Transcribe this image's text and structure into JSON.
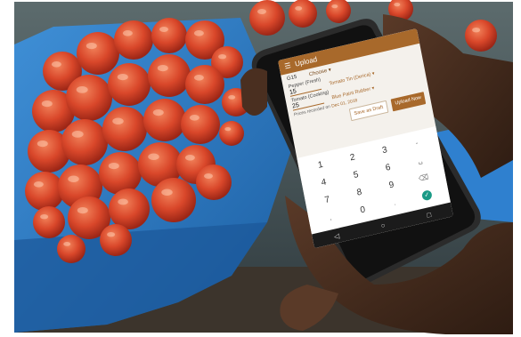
{
  "app": {
    "title": "Upload",
    "market": "G15",
    "market_dropdown": "Choose",
    "fields": [
      {
        "label": "Pepper (Fresh)",
        "value": "15",
        "unit": "Tomato Tin (Derica)"
      },
      {
        "label": "Tomato (Cooking)",
        "value": "25",
        "unit": "Blue Paint Rubber"
      }
    ],
    "prices_recorded_prefix": "Prices recorded on",
    "prices_recorded_date": "Dec 01, 2018",
    "save_draft": "Save as Draft",
    "upload_now": "Upload Now"
  },
  "keypad": {
    "keys": [
      "1",
      "2",
      "3",
      "-",
      "4",
      "5",
      "6",
      "␣",
      "7",
      "8",
      "9",
      "⌫",
      ",",
      "0",
      ".",
      "✓"
    ]
  },
  "navbar": {
    "back": "◁",
    "home": "○",
    "recent": "□"
  },
  "colors": {
    "brand": "#a8692b",
    "confirm": "#1a9a86",
    "tarp": "#2a78c4",
    "tomato": "#d8482a"
  },
  "icons": [
    "menu-icon",
    "dropdown-arrow-icon",
    "backspace-icon",
    "check-icon",
    "back-icon",
    "home-icon",
    "recent-apps-icon"
  ]
}
